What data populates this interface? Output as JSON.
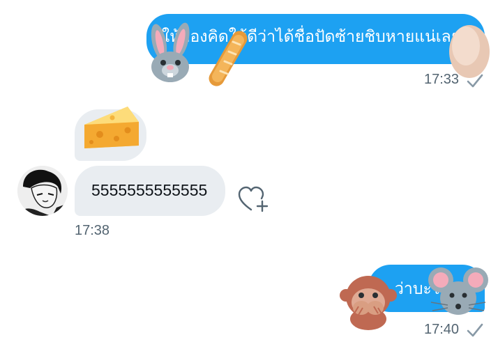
{
  "conversation": {
    "message_1": {
      "text": "ให้ลองคิดให้ดีว่าได้ชื่อปัดซ้ายชิบหายแน่เลย",
      "time": "17:33",
      "status_icon": "read-check-icon",
      "stickers": [
        "rabbit-face-icon",
        "baguette-icon",
        "egg-icon"
      ]
    },
    "message_2": {
      "sticker": "cheese-wedge-icon"
    },
    "message_3": {
      "text": "5555555555555",
      "time": "17:38",
      "sender_avatar": "avatar",
      "reaction_button_icon": "heart-plus-icon"
    },
    "message_4": {
      "text": "ว่าบะไ",
      "time": "17:40",
      "status_icon": "read-check-icon",
      "stickers": [
        "see-no-evil-monkey-icon",
        "mouse-face-icon"
      ]
    }
  },
  "colors": {
    "outgoing_bubble": "#1da1f2",
    "incoming_bubble": "#e9edf1",
    "timestamp": "#536471"
  }
}
